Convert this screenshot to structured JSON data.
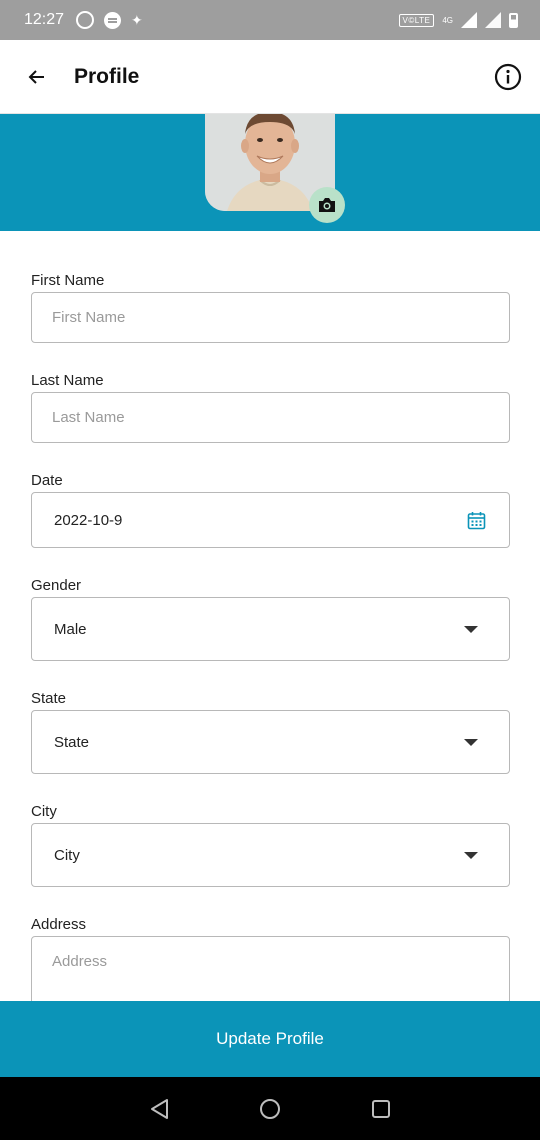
{
  "status_bar": {
    "time": "12:27",
    "volte": "V©LTE",
    "network": "4G"
  },
  "app_bar": {
    "title": "Profile"
  },
  "colors": {
    "accent": "#0b94b8",
    "camera_bg": "#b9e1c9",
    "status_bar": "#9e9e9e"
  },
  "form": {
    "first_name": {
      "label": "First Name",
      "placeholder": "First Name",
      "value": ""
    },
    "last_name": {
      "label": "Last Name",
      "placeholder": "Last Name",
      "value": ""
    },
    "date": {
      "label": "Date",
      "value": "2022-10-9",
      "icon": "calendar-icon"
    },
    "gender": {
      "label": "Gender",
      "value": "Male"
    },
    "state": {
      "label": "State",
      "value": "State"
    },
    "city": {
      "label": "City",
      "value": "City"
    },
    "address": {
      "label": "Address",
      "placeholder": "Address",
      "value": ""
    }
  },
  "actions": {
    "update_label": "Update Profile"
  },
  "icons": {
    "back": "back-arrow-icon",
    "info": "info-icon",
    "camera": "camera-icon",
    "dropdown": "dropdown-arrow-icon",
    "nav_back": "nav-back-icon",
    "nav_home": "nav-home-icon",
    "nav_recents": "nav-recents-icon"
  }
}
